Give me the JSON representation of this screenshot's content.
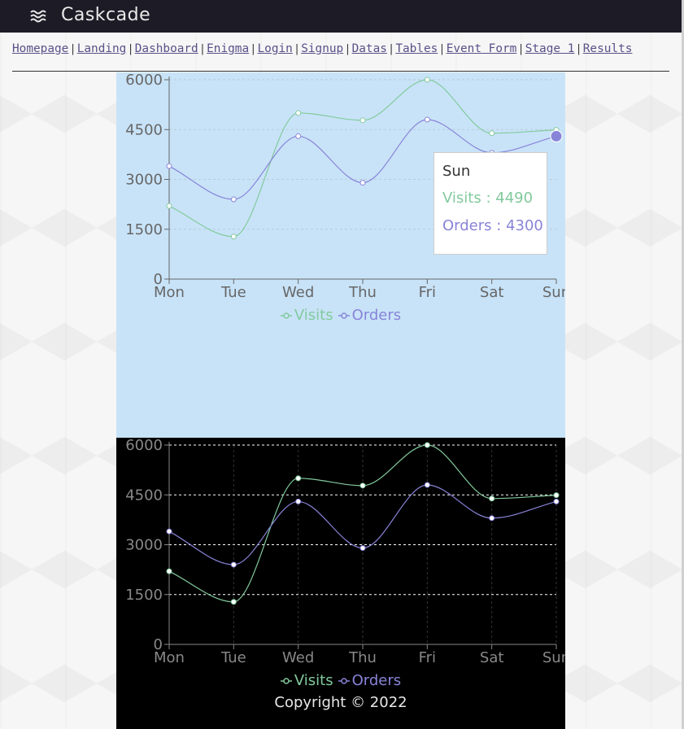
{
  "app": {
    "title": "Caskcade",
    "logo_icon": "waves-icon"
  },
  "nav": {
    "links": [
      "Homepage",
      "Landing",
      "Dashboard",
      "Enigma",
      "Login",
      "Signup",
      "Datas",
      "Tables",
      "Event Form",
      "Stage 1",
      "Results"
    ],
    "separator": "|"
  },
  "chart_data": [
    {
      "type": "line",
      "theme": "light",
      "categories": [
        "Mon",
        "Tue",
        "Wed",
        "Thu",
        "Fri",
        "Sat",
        "Sun"
      ],
      "series": [
        {
          "name": "Visits",
          "values": [
            2200,
            1280,
            5000,
            4780,
            6000,
            4390,
            4490
          ],
          "color": "#82ca9d"
        },
        {
          "name": "Orders",
          "values": [
            3400,
            2400,
            4300,
            2900,
            4800,
            3800,
            4300
          ],
          "color": "#8884d8"
        }
      ],
      "y_ticks": [
        0,
        1500,
        3000,
        4500,
        6000
      ],
      "ylim": [
        0,
        6000
      ],
      "grid": true,
      "legend": "bottom",
      "active_index": 6,
      "tooltip": {
        "title": "Sun",
        "visits_label": "Visits : 4490",
        "orders_label": "Orders : 4300"
      }
    },
    {
      "type": "line",
      "theme": "dark",
      "categories": [
        "Mon",
        "Tue",
        "Wed",
        "Thu",
        "Fri",
        "Sat",
        "Sun"
      ],
      "series": [
        {
          "name": "Visits",
          "values": [
            2200,
            1280,
            5000,
            4780,
            6000,
            4390,
            4490
          ],
          "color": "#82ca9d"
        },
        {
          "name": "Orders",
          "values": [
            3400,
            2400,
            4300,
            2900,
            4800,
            3800,
            4300
          ],
          "color": "#8884d8"
        }
      ],
      "y_ticks": [
        0,
        1500,
        3000,
        4500,
        6000
      ],
      "ylim": [
        0,
        6000
      ],
      "grid": true,
      "legend": "bottom"
    }
  ],
  "footer": {
    "copyright": "Copyright © 2022"
  }
}
